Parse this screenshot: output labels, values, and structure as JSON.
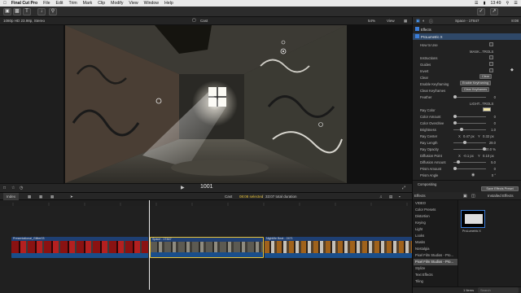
{
  "menubar": {
    "app": "Final Cut Pro",
    "items": [
      "File",
      "Edit",
      "Trim",
      "Mark",
      "Clip",
      "Modify",
      "View",
      "Window",
      "Help"
    ],
    "clock": "13:49"
  },
  "browser": {
    "format": "1080p HD 23.98p, Stereo"
  },
  "viewer": {
    "clip_title": "Cast",
    "zoom": "54%",
    "view_label": "View",
    "timecode": "1001"
  },
  "inspector": {
    "clip_name": "Space - 1T847",
    "duration": "8:08",
    "section_effects": "Effects",
    "effect_name": "ProLumetric X",
    "rows": [
      {
        "label": "How to Use"
      },
      {
        "label": "MASK...TROLS",
        "header": true
      },
      {
        "label": "Instructions"
      },
      {
        "label": "Guides"
      },
      {
        "label": "Invert"
      },
      {
        "label": "Clear",
        "button": "Clear"
      },
      {
        "label": "Enable Keyframing",
        "button": "Enable Keyframing"
      },
      {
        "label": "Clear Keyframes",
        "button": "Clear Keyframes"
      },
      {
        "label": "Feather",
        "value": "0"
      },
      {
        "label": "LIGHT...TROLS",
        "header": true
      },
      {
        "label": "Ray Color"
      },
      {
        "label": "Color Amount",
        "value": "0"
      },
      {
        "label": "Color Overdrive",
        "value": "0"
      },
      {
        "label": "Brightness",
        "value": "1.0"
      },
      {
        "label": "Ray Center",
        "x": "0.47 px",
        "y": "0.32 px"
      },
      {
        "label": "Ray Length",
        "value": "29.0"
      },
      {
        "label": "Ray Opacity",
        "value": "100.0 %"
      },
      {
        "label": "Diffusion Point",
        "x": "-0.1 px",
        "y": "0.10 px"
      },
      {
        "label": "Diffusion Amount",
        "value": "5.0"
      },
      {
        "label": "Prism Amount",
        "value": "0"
      },
      {
        "label": "Prism Angle",
        "value": "0 °"
      }
    ],
    "compositing": "Compositing",
    "save_preset": "Save Effects Preset"
  },
  "timeline": {
    "index_label": "Index",
    "project": "Cast",
    "selection_status": "08:08 selected",
    "total_duration": "33:07 total duration",
    "clips": [
      {
        "name": "Presentational_Glitter03"
      },
      {
        "name": "Space - 1T847"
      },
      {
        "name": "Nightlife Beat - 2471"
      }
    ]
  },
  "effects_browser": {
    "title": "Effects",
    "installed": "Installed Effects",
    "categories": [
      "VIDEO",
      "Color Presets",
      "Distortion",
      "Keying",
      "Light",
      "Looks",
      "Masks",
      "Nostalgia",
      "Pixel Film Studios - Pro...",
      "Pixel Film Studios - Pro...",
      "Stylize",
      "Text Effects",
      "Tiling"
    ],
    "selected_category_index": 9,
    "thumb_label": "ProLumetric X",
    "search_placeholder": "Search",
    "count": "1 Items"
  },
  "colors": {
    "accent": "#3b7dd8",
    "selected_clip_border": "#e8c33a",
    "ray_color_swatch": "#f2e6a6"
  }
}
